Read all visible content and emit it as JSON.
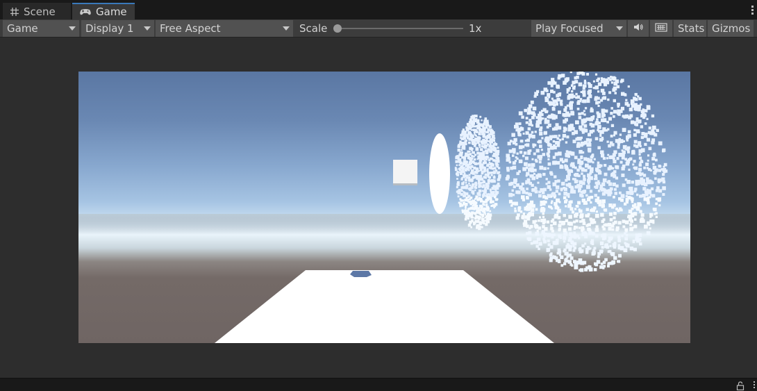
{
  "tabs": [
    {
      "label": "Scene",
      "icon": "grid-hash-icon",
      "active": false
    },
    {
      "label": "Game",
      "icon": "gamepad-icon",
      "active": true
    }
  ],
  "toolbar": {
    "view_dropdown": "Game",
    "display_dropdown": "Display 1",
    "aspect_dropdown": "Free Aspect",
    "scale_label": "Scale",
    "scale_value": "1x",
    "scale_slider_level": 0.0,
    "play_mode_dropdown": "Play Focused",
    "mute_icon": "speaker-icon",
    "keyboard_icon": "keyboard-icon",
    "stats_label": "Stats",
    "gizmos_label": "Gizmos"
  },
  "colors": {
    "tab_active_accent": "#3a79bb",
    "toolbar_bg": "#3c3c3c",
    "dropdown_bg": "#515151",
    "game_background": "#2d2d2d",
    "ground": "#6f6563",
    "sky_top": "#5a77a3",
    "horizon": "#e9f4fb"
  },
  "statusbar": {
    "lock_icon": "lock-icon"
  }
}
